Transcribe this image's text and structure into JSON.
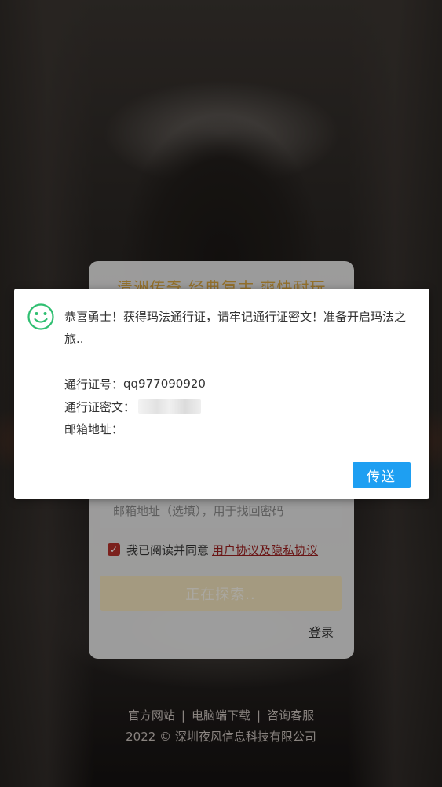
{
  "card": {
    "title": "清洲传奇 经典复古 爽快耐玩",
    "email_placeholder": "邮箱地址（选填），用于找回密码",
    "agree_text": "我已阅读并同意",
    "agree_link": "用户协议及隐私协议",
    "search_button": "正在探索..",
    "login_link": "登录"
  },
  "footer": {
    "links": [
      "官方网站",
      "电脑端下载",
      "咨询客服"
    ],
    "copyright": "2022 © 深圳夜风信息科技有限公司"
  },
  "dialog": {
    "icon": "smile-icon",
    "message": "恭喜勇士！获得玛法通行证，请牢记通行证密文！准备开启玛法之旅..",
    "id_label": "通行证号：",
    "id_value": "qq977090920",
    "password_label": "通行证密文：",
    "email_label": "邮箱地址：",
    "send_button": "传送"
  },
  "colors": {
    "accent_blue": "#1e9ff2",
    "title_gold": "#d9a640",
    "checkbox_red": "#b5322b",
    "smile_green": "#2fbf71"
  }
}
